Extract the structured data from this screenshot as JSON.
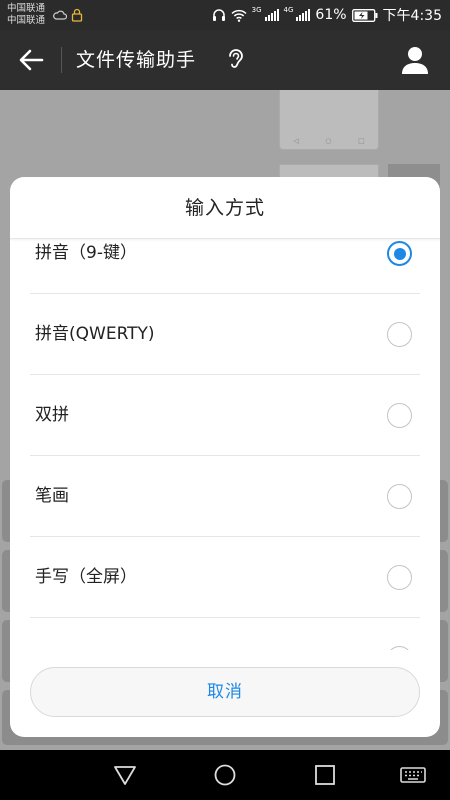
{
  "status_bar": {
    "carrier_1": "中国联通",
    "carrier_2": "中国联通",
    "network_1": "3G",
    "network_2": "4G",
    "battery": "61%",
    "time": "下午4:35"
  },
  "header": {
    "title": "文件传输助手",
    "back_icon": "arrow-left-icon",
    "ear_icon": "ear-icon",
    "profile_icon": "person-icon"
  },
  "dialog": {
    "title": "输入方式",
    "options": [
      {
        "label": "拼音（9-键）",
        "selected": true
      },
      {
        "label": "拼音(QWERTY)",
        "selected": false
      },
      {
        "label": "双拼",
        "selected": false
      },
      {
        "label": "笔画",
        "selected": false
      },
      {
        "label": "手写（全屏）",
        "selected": false
      }
    ],
    "cancel_label": "取消"
  },
  "colors": {
    "accent": "#1e88e5",
    "title_bar": "#2e2e2e",
    "dim_background": "#a4a4a4"
  }
}
